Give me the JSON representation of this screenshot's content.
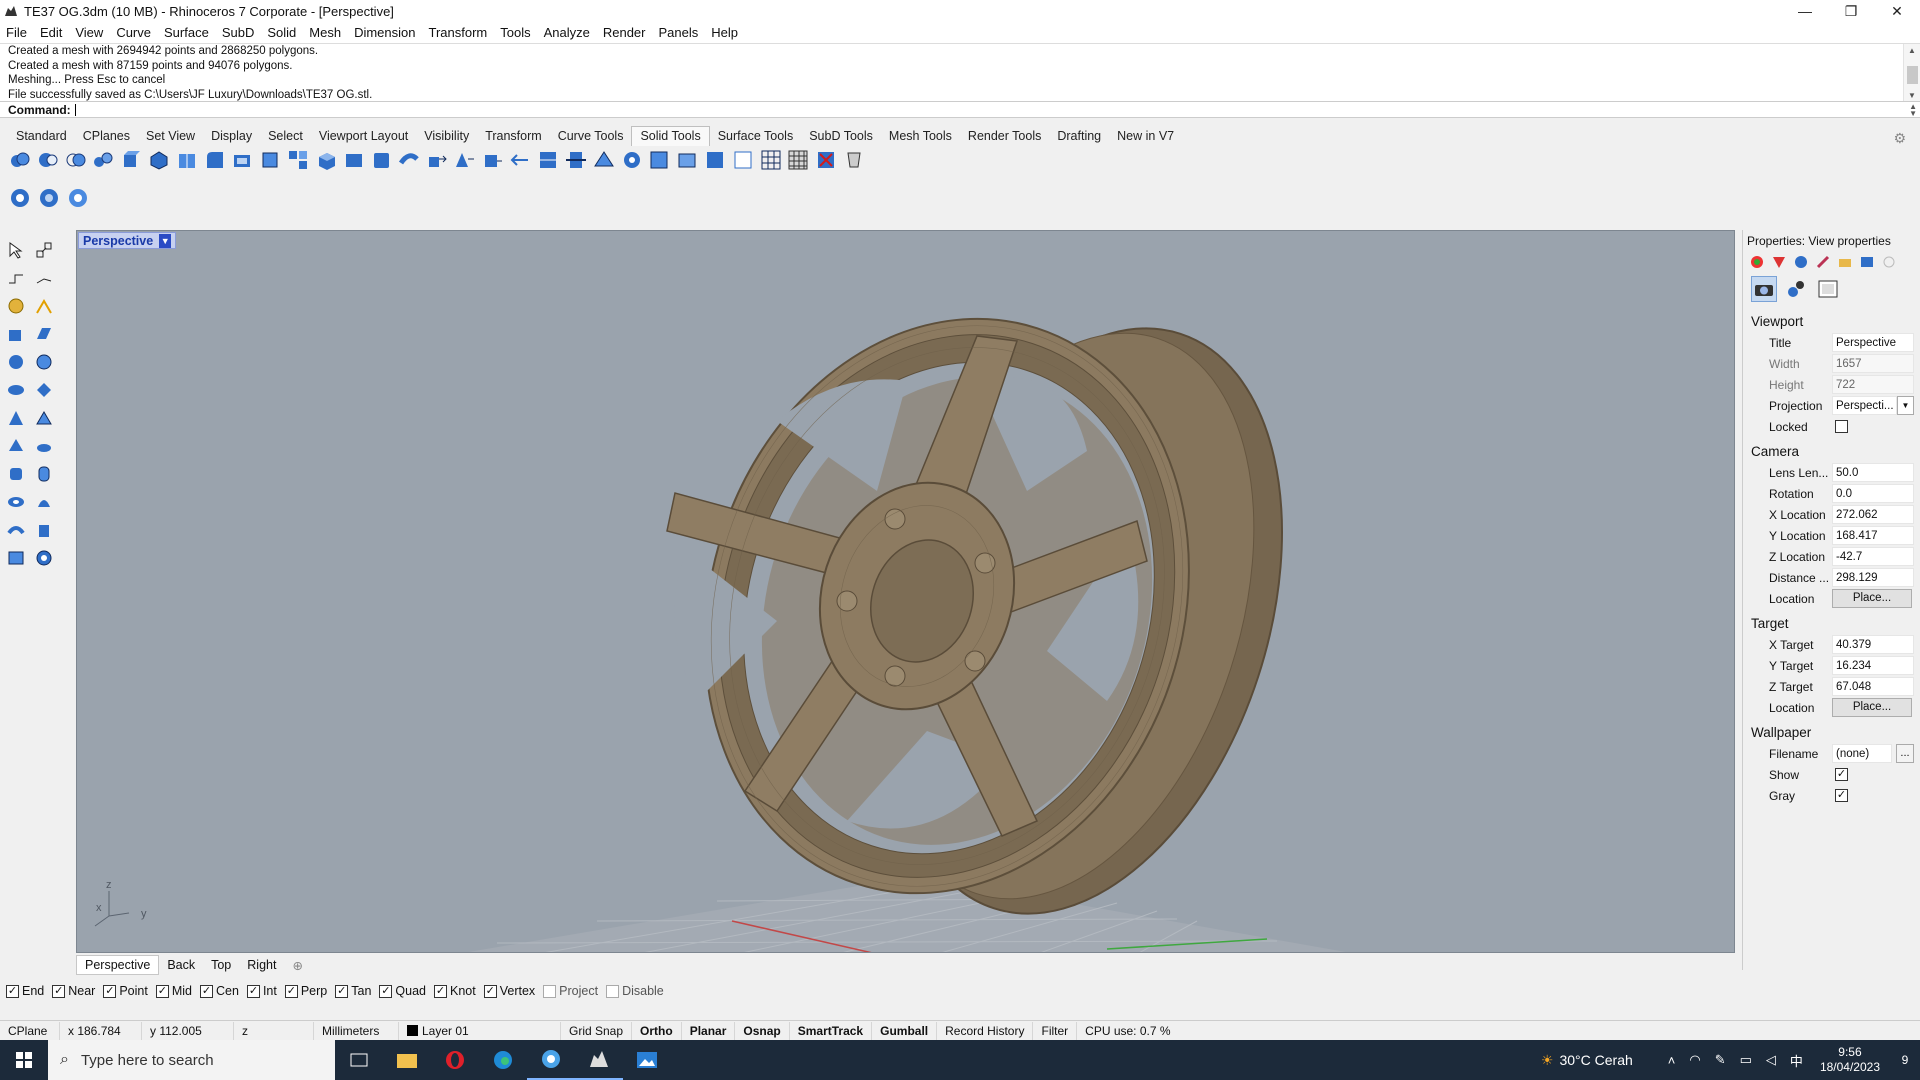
{
  "window": {
    "title": "TE37 OG.3dm (10 MB) - Rhinoceros 7 Corporate - [Perspective]",
    "controls": [
      "—",
      "❐",
      "✕"
    ]
  },
  "menu": [
    "File",
    "Edit",
    "View",
    "Curve",
    "Surface",
    "SubD",
    "Solid",
    "Mesh",
    "Dimension",
    "Transform",
    "Tools",
    "Analyze",
    "Render",
    "Panels",
    "Help"
  ],
  "history": [
    "Created a mesh with 2694942 points and 2868250 polygons.",
    "Created a mesh with 87159 points and 94076 polygons.",
    "Meshing... Press Esc to cancel",
    "File successfully saved as C:\\Users\\JF Luxury\\Downloads\\TE37 OG.stl."
  ],
  "command": {
    "label": "Command:",
    "value": ""
  },
  "toolbar_tabs": [
    "Standard",
    "CPlanes",
    "Set View",
    "Display",
    "Select",
    "Viewport Layout",
    "Visibility",
    "Transform",
    "Curve Tools",
    "Solid Tools",
    "Surface Tools",
    "SubD Tools",
    "Mesh Tools",
    "Render Tools",
    "Drafting",
    "New in V7"
  ],
  "active_tab": "Solid Tools",
  "viewport": {
    "title": "Perspective",
    "axis_labels": {
      "x": "x",
      "y": "y",
      "z": "z"
    }
  },
  "viewport_tabs": [
    "Perspective",
    "Back",
    "Top",
    "Right"
  ],
  "properties": {
    "panel_title": "Properties: View properties",
    "viewport_section": "Viewport",
    "viewport_rows": [
      {
        "label": "Title",
        "value": "Perspective"
      },
      {
        "label": "Width",
        "value": "1657"
      },
      {
        "label": "Height",
        "value": "722"
      },
      {
        "label": "Projection",
        "value": "Perspecti..."
      },
      {
        "label": "Locked",
        "value": ""
      }
    ],
    "camera_section": "Camera",
    "camera_rows": [
      {
        "label": "Lens Len...",
        "value": "50.0"
      },
      {
        "label": "Rotation",
        "value": "0.0"
      },
      {
        "label": "X Location",
        "value": "272.062"
      },
      {
        "label": "Y Location",
        "value": "168.417"
      },
      {
        "label": "Z Location",
        "value": "-42.7"
      },
      {
        "label": "Distance ...",
        "value": "298.129"
      },
      {
        "label": "Location",
        "value": "Place..."
      }
    ],
    "target_section": "Target",
    "target_rows": [
      {
        "label": "X Target",
        "value": "40.379"
      },
      {
        "label": "Y Target",
        "value": "16.234"
      },
      {
        "label": "Z Target",
        "value": "67.048"
      },
      {
        "label": "Location",
        "value": "Place..."
      }
    ],
    "wallpaper_section": "Wallpaper",
    "wallpaper_rows": [
      {
        "label": "Filename",
        "value": "(none)"
      },
      {
        "label": "Show",
        "value": "✓"
      },
      {
        "label": "Gray",
        "value": "✓"
      }
    ],
    "ellipsis": "..."
  },
  "osnaps": [
    {
      "label": "End",
      "checked": "✓"
    },
    {
      "label": "Near",
      "checked": "✓"
    },
    {
      "label": "Point",
      "checked": "✓"
    },
    {
      "label": "Mid",
      "checked": "✓"
    },
    {
      "label": "Cen",
      "checked": "✓"
    },
    {
      "label": "Int",
      "checked": "✓"
    },
    {
      "label": "Perp",
      "checked": "✓"
    },
    {
      "label": "Tan",
      "checked": "✓"
    },
    {
      "label": "Quad",
      "checked": "✓"
    },
    {
      "label": "Knot",
      "checked": "✓"
    },
    {
      "label": "Vertex",
      "checked": "✓"
    },
    {
      "label": "Project",
      "checked": ""
    },
    {
      "label": "Disable",
      "checked": ""
    }
  ],
  "status": {
    "cplane": "CPlane",
    "x": "x 186.784",
    "y": "y 112.005",
    "z": "z",
    "units": "Millimeters",
    "layer": "Layer 01",
    "grid_snap": "Grid Snap",
    "ortho": "Ortho",
    "planar": "Planar",
    "osnap": "Osnap",
    "smarttrack": "SmartTrack",
    "gumball": "Gumball",
    "record_history": "Record History",
    "filter": "Filter",
    "cpu": "CPU use: 0.7 %"
  },
  "taskbar": {
    "search_placeholder": "Type here to search",
    "weather": "30°C  Cerah",
    "time": "9:56",
    "date": "18/04/2023",
    "notifications": "9"
  },
  "colors": {
    "viewport_bg": "#9aa3ad",
    "wheel": "#8b7a62",
    "accent": "#2a4bc5"
  }
}
